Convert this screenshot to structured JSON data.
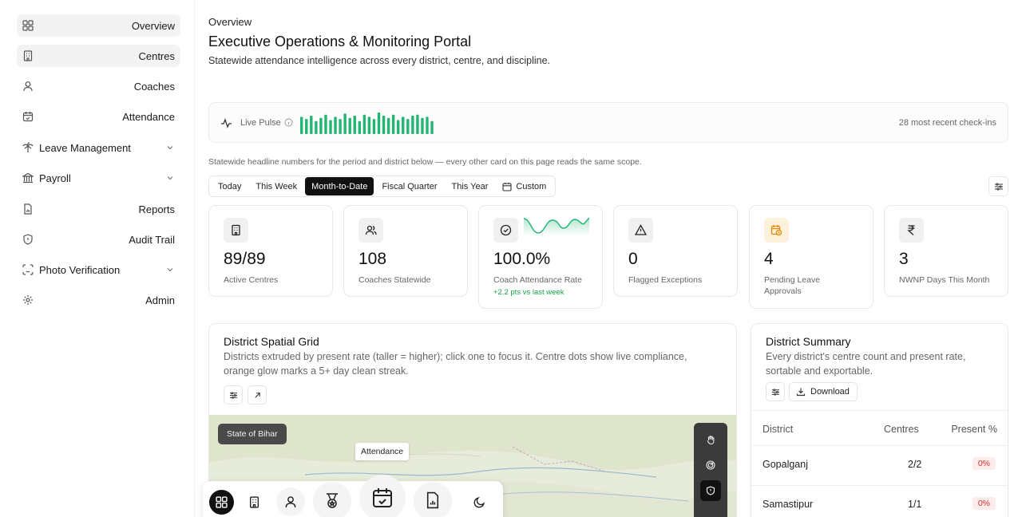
{
  "sidebar": {
    "items": [
      {
        "label": "Overview",
        "icon": "grid-icon"
      },
      {
        "label": "Centres",
        "icon": "building-icon"
      },
      {
        "label": "Coaches",
        "icon": "user-icon"
      },
      {
        "label": "Attendance",
        "icon": "calendar-check-icon"
      },
      {
        "label": "Leave Management",
        "icon": "palm-tree-icon"
      },
      {
        "label": "Payroll",
        "icon": "landmark-icon"
      },
      {
        "label": "Reports",
        "icon": "file-chart-icon"
      },
      {
        "label": "Audit Trail",
        "icon": "shield-icon"
      },
      {
        "label": "Photo Verification",
        "icon": "scan-face-icon"
      },
      {
        "label": "Admin",
        "icon": "gear-icon"
      }
    ]
  },
  "header": {
    "breadcrumb": "Overview",
    "title": "Executive Operations & Monitoring Portal",
    "subtitle": "Statewide attendance intelligence across every district, centre, and discipline."
  },
  "pulse": {
    "label": "Live Pulse",
    "recent": "28 most recent check-ins",
    "bar_levels": [
      0.8,
      0.7,
      0.85,
      0.6,
      0.75,
      0.9,
      0.65,
      0.8,
      0.7,
      0.95,
      0.75,
      0.85,
      0.6,
      0.9,
      0.8,
      0.7,
      1.0,
      0.85,
      0.75,
      0.9,
      0.65,
      0.8,
      0.7,
      0.85,
      0.9,
      0.75,
      0.8,
      0.6
    ]
  },
  "scope_note": "Statewide headline numbers for the period and district below — every other card on this page reads the same scope.",
  "periods": [
    "Today",
    "This Week",
    "Month-to-Date",
    "Fiscal Quarter",
    "This Year",
    "Custom"
  ],
  "period_selected": "Month-to-Date",
  "kpis": [
    {
      "value": "89/89",
      "label": "Active Centres",
      "icon": "building-icon"
    },
    {
      "value": "108",
      "label": "Coaches Statewide",
      "icon": "users-icon"
    },
    {
      "value": "100.0%",
      "label": "Coach Attendance Rate",
      "delta": "+2.2 pts vs last week",
      "icon": "check-circle-icon"
    },
    {
      "value": "0",
      "label": "Flagged Exceptions",
      "icon": "alert-triangle-icon"
    },
    {
      "value": "4",
      "label": "Pending Leave Approvals",
      "icon": "calendar-clock-icon"
    },
    {
      "value": "3",
      "label": "NWNP Days This Month",
      "icon": "rupee-icon"
    }
  ],
  "grid_card": {
    "title": "District Spatial Grid",
    "desc": "Districts extruded by present rate (taller = higher); click one to focus it. Centre dots show live compliance, orange glow marks a 5+ day clean streak.",
    "map_pill": "State of Bihar",
    "map_tip": "Attendance"
  },
  "summary_card": {
    "title": "District Summary",
    "desc": "Every district's centre count and present rate, sortable and exportable.",
    "download": "Download",
    "columns": [
      "District",
      "Centres",
      "Present %"
    ],
    "rows": [
      {
        "district": "Gopalganj",
        "centres": "2/2",
        "present": "0%"
      },
      {
        "district": "Samastipur",
        "centres": "1/1",
        "present": "0%"
      }
    ]
  },
  "colors": {
    "accent_green": "#16a34a",
    "pulse_green": "#22b573",
    "danger": "#d0302a"
  }
}
